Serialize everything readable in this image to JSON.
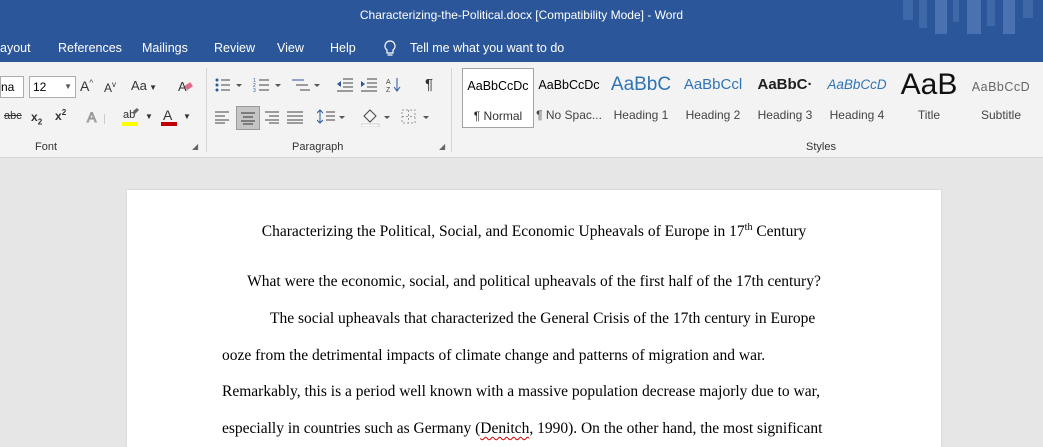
{
  "titlebar": {
    "title": "Characterizing-the-Political.docx [Compatibility Mode]  -  Word"
  },
  "menu": {
    "items": [
      "ayout",
      "References",
      "Mailings",
      "Review",
      "View",
      "Help"
    ],
    "tell_me": "Tell me what you want to do"
  },
  "ribbon": {
    "font": {
      "name": "na",
      "size": "12",
      "change_case": "Aa",
      "group_label": "Font"
    },
    "paragraph": {
      "group_label": "Paragraph"
    },
    "styles": {
      "group_label": "Styles",
      "items": [
        {
          "preview": "AaBbCcDc",
          "label": "¶ Normal"
        },
        {
          "preview": "AaBbCcDc",
          "label": "¶ No Spac..."
        },
        {
          "preview": "AaBbC",
          "label": "Heading 1"
        },
        {
          "preview": "AaBbCcl",
          "label": "Heading 2"
        },
        {
          "preview": "AaBbC·",
          "label": "Heading 3"
        },
        {
          "preview": "AaBbCcD",
          "label": "Heading 4"
        },
        {
          "preview": "AaB",
          "label": "Title"
        },
        {
          "preview": "AaBbCcD",
          "label": "Subtitle"
        }
      ]
    }
  },
  "colors": {
    "accent": "#2b579a",
    "highlight": "#ffff00",
    "font_color": "#c00000"
  },
  "document": {
    "title": "Characterizing the Political, Social, and Economic Upheavals of Europe in 17",
    "title_sup": "th",
    "title_end": " Century",
    "question": "What were the economic, social, and political upheavals of the first half of the 17th century?",
    "p1": "The social upheavals that characterized the General Crisis of the 17th century in Europe",
    "p2": "ooze from the detrimental impacts of climate change and patterns of migration and war.",
    "p3": "Remarkably, this is a period well known with a massive population decrease majorly due to war,",
    "p4_start": "especially in countries such as Germany (",
    "p4_err": "Denitch",
    "p4_end": ", 1990). On the other hand, the most significant"
  }
}
